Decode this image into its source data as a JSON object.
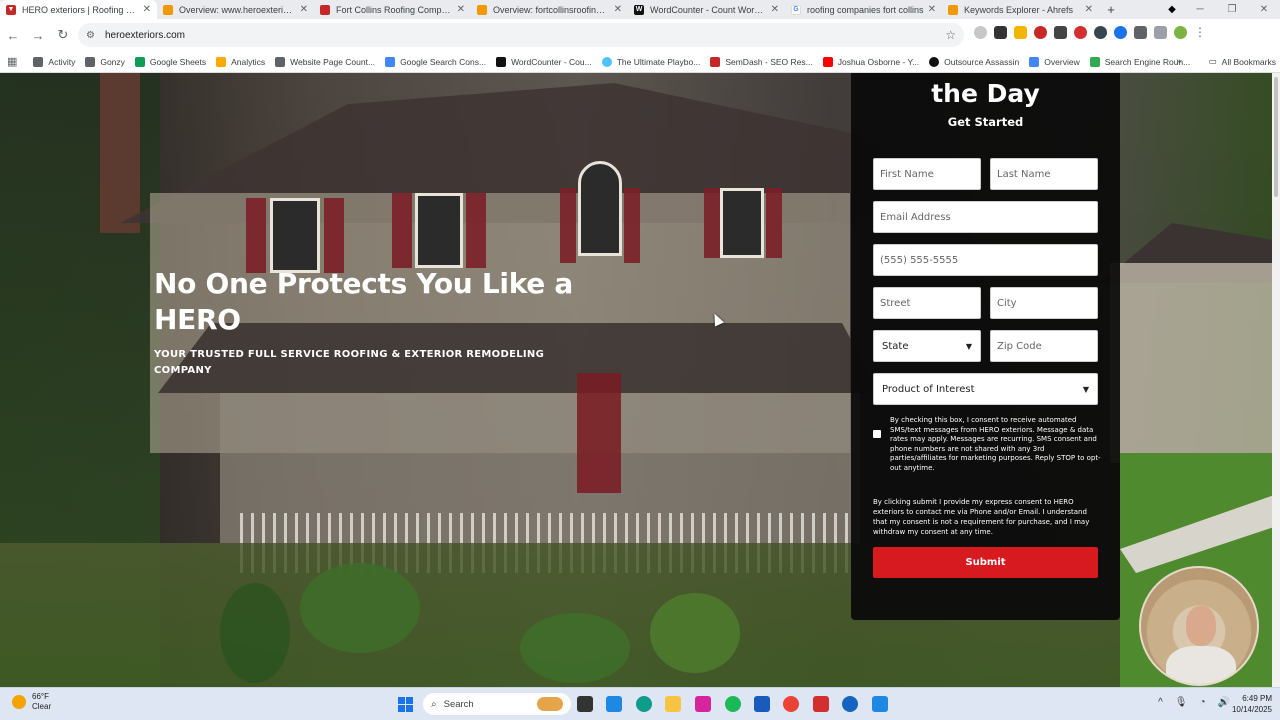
{
  "browser": {
    "tabs": [
      {
        "label": "HERO exteriors | Roofing & Ext",
        "active": true,
        "favicon_color": "#c62828"
      },
      {
        "label": "Overview: www.heroexteriors.c",
        "active": false,
        "favicon_color": "#f29900"
      },
      {
        "label": "Fort Collins Roofing Company",
        "active": false,
        "favicon_color": "#c62828"
      },
      {
        "label": "Overview: fortcollinsroofing.co",
        "active": false,
        "favicon_color": "#f29900"
      },
      {
        "label": "WordCounter - Count Words &",
        "active": false,
        "favicon_color": "#111111"
      },
      {
        "label": "roofing companies fort collins",
        "active": false,
        "favicon_color": "#4285f4"
      },
      {
        "label": "Keywords Explorer - Ahrefs",
        "active": false,
        "favicon_color": "#f29900"
      }
    ],
    "new_tab": "+",
    "url": "heroexteriors.com",
    "bookmarks": [
      {
        "label": "Activity",
        "color": "#5f6368"
      },
      {
        "label": "Gonzy",
        "color": "#5f6368"
      },
      {
        "label": "Google Sheets",
        "color": "#0f9d58"
      },
      {
        "label": "Analytics",
        "color": "#f9ab00"
      },
      {
        "label": "Website Page Count...",
        "color": "#5f6368"
      },
      {
        "label": "Google Search Cons...",
        "color": "#4285f4"
      },
      {
        "label": "WordCounter - Cou...",
        "color": "#111111"
      },
      {
        "label": "The Ultimate Playbo...",
        "color": "#4fc3f7"
      },
      {
        "label": "SemDash - SEO Res...",
        "color": "#c62828"
      },
      {
        "label": "Joshua Osborne - Y...",
        "color": "#ff0000"
      },
      {
        "label": "Outsource Assassin",
        "color": "#111111"
      },
      {
        "label": "Overview",
        "color": "#4285f4"
      },
      {
        "label": "Search Engine Roun...",
        "color": "#34a853"
      }
    ],
    "all_bookmarks": "All Bookmarks"
  },
  "hero": {
    "headline": "No One Protects You Like a HERO",
    "subheadline": "YOUR TRUSTED FULL SERVICE ROOFING & EXTERIOR REMODELING COMPANY"
  },
  "form": {
    "title": "the Day",
    "subtitle": "Get Started",
    "first_name_placeholder": "First Name",
    "last_name_placeholder": "Last Name",
    "email_placeholder": "Email Address",
    "phone_placeholder": "(555) 555-5555",
    "street_placeholder": "Street",
    "city_placeholder": "City",
    "state_select": "State",
    "zip_placeholder": "Zip Code",
    "product_select": "Product of Interest",
    "sms_consent": "By checking this box, I consent to receive automated SMS/text messages from HERO exteriors. Message & data rates may apply. Messages are recurring. SMS consent and phone numbers are not shared with any 3rd parties/affiliates for marketing purposes. Reply STOP to opt-out anytime.",
    "legal_text": "By clicking submit I provide my express consent to HERO exteriors to contact me via Phone and/or Email. I understand that my consent is not a requirement for purchase, and I may withdraw my consent at any time.",
    "submit_label": "Submit",
    "submit_color": "#d71920"
  },
  "taskbar": {
    "weather_temp": "66°F",
    "weather_desc": "Clear",
    "search_label": "Search",
    "time": "6:49 PM",
    "date": "10/14/2025"
  }
}
